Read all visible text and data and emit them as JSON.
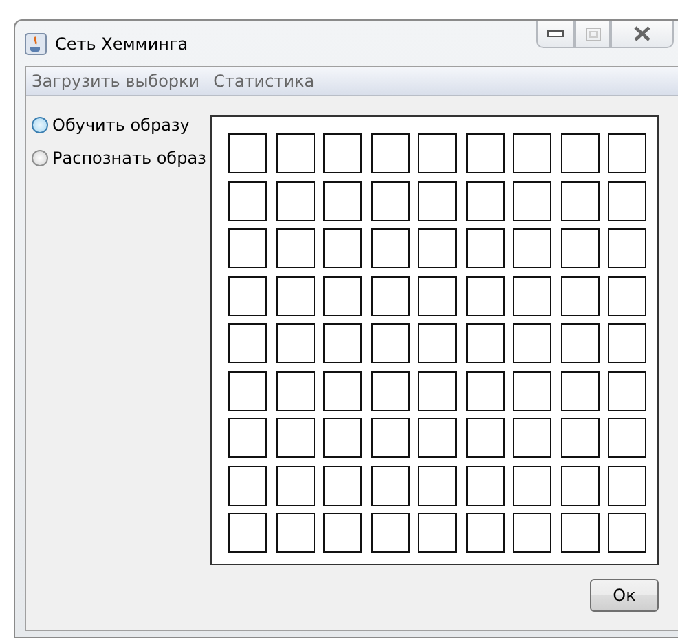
{
  "window": {
    "title": "Сеть Хемминга"
  },
  "menu": [
    "Загрузить выборки",
    "Статистика"
  ],
  "modes": [
    {
      "label": "Обучить образу",
      "selected": false,
      "hovered": true
    },
    {
      "label": "Распознать образ",
      "selected": false,
      "hovered": false
    }
  ],
  "grid": [
    [
      {
        "filled": false
      },
      {
        "filled": false
      },
      {
        "filled": false
      },
      {
        "filled": false
      },
      {
        "filled": false
      },
      {
        "filled": false
      },
      {
        "filled": false
      },
      {
        "filled": false
      },
      {
        "filled": false
      }
    ],
    [
      {
        "filled": false
      },
      {
        "filled": false
      },
      {
        "filled": false
      },
      {
        "filled": false
      },
      {
        "filled": false
      },
      {
        "filled": false
      },
      {
        "filled": false
      },
      {
        "filled": false
      },
      {
        "filled": false
      }
    ],
    [
      {
        "filled": false
      },
      {
        "filled": false
      },
      {
        "filled": false
      },
      {
        "filled": false
      },
      {
        "filled": false
      },
      {
        "filled": false
      },
      {
        "filled": false
      },
      {
        "filled": false
      },
      {
        "filled": false
      }
    ],
    [
      {
        "filled": false
      },
      {
        "filled": false
      },
      {
        "filled": false
      },
      {
        "filled": false
      },
      {
        "filled": false
      },
      {
        "filled": false
      },
      {
        "filled": false
      },
      {
        "filled": false
      },
      {
        "filled": false
      }
    ],
    [
      {
        "filled": false
      },
      {
        "filled": false
      },
      {
        "filled": false
      },
      {
        "filled": false
      },
      {
        "filled": false
      },
      {
        "filled": false
      },
      {
        "filled": false
      },
      {
        "filled": false
      },
      {
        "filled": false
      }
    ],
    [
      {
        "filled": false
      },
      {
        "filled": false
      },
      {
        "filled": false
      },
      {
        "filled": false
      },
      {
        "filled": false
      },
      {
        "filled": false
      },
      {
        "filled": false
      },
      {
        "filled": false
      },
      {
        "filled": false
      }
    ],
    [
      {
        "filled": false
      },
      {
        "filled": false
      },
      {
        "filled": false
      },
      {
        "filled": false
      },
      {
        "filled": false
      },
      {
        "filled": false
      },
      {
        "filled": false
      },
      {
        "filled": false
      },
      {
        "filled": false
      }
    ],
    [
      {
        "filled": false
      },
      {
        "filled": false
      },
      {
        "filled": false
      },
      {
        "filled": false
      },
      {
        "filled": false
      },
      {
        "filled": false
      },
      {
        "filled": false
      },
      {
        "filled": false
      },
      {
        "filled": false
      }
    ],
    [
      {
        "filled": false
      },
      {
        "filled": false
      },
      {
        "filled": false
      },
      {
        "filled": false
      },
      {
        "filled": false
      },
      {
        "filled": false
      },
      {
        "filled": false
      },
      {
        "filled": false
      },
      {
        "filled": false
      }
    ]
  ],
  "ok_button": "Ок"
}
